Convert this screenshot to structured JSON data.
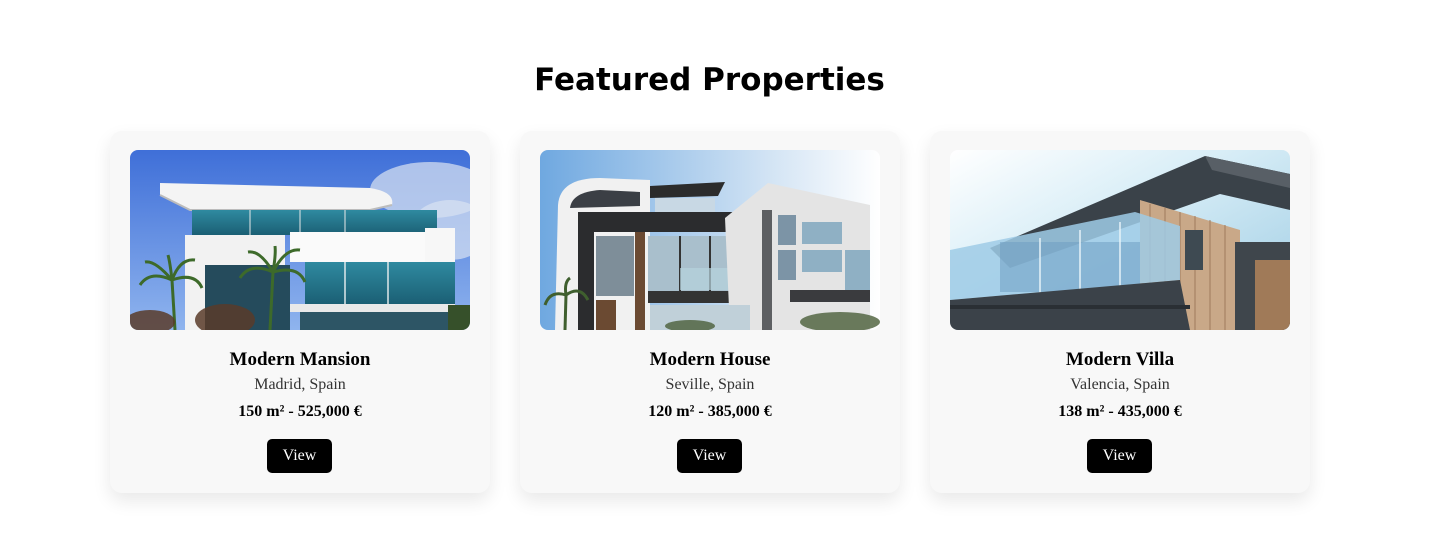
{
  "section": {
    "title": "Featured Properties"
  },
  "properties": [
    {
      "name": "Modern Mansion",
      "location": "Madrid, Spain",
      "details": "150 m² - 525,000 €",
      "button_label": "View"
    },
    {
      "name": "Modern House",
      "location": "Seville, Spain",
      "details": "120 m² - 385,000 €",
      "button_label": "View"
    },
    {
      "name": "Modern Villa",
      "location": "Valencia, Spain",
      "details": "138 m² - 435,000 €",
      "button_label": "View"
    }
  ],
  "colors": {
    "page_background": "#ffffff",
    "card_background": "#f8f8f8",
    "button_background": "#000000",
    "button_text": "#ffffff"
  }
}
